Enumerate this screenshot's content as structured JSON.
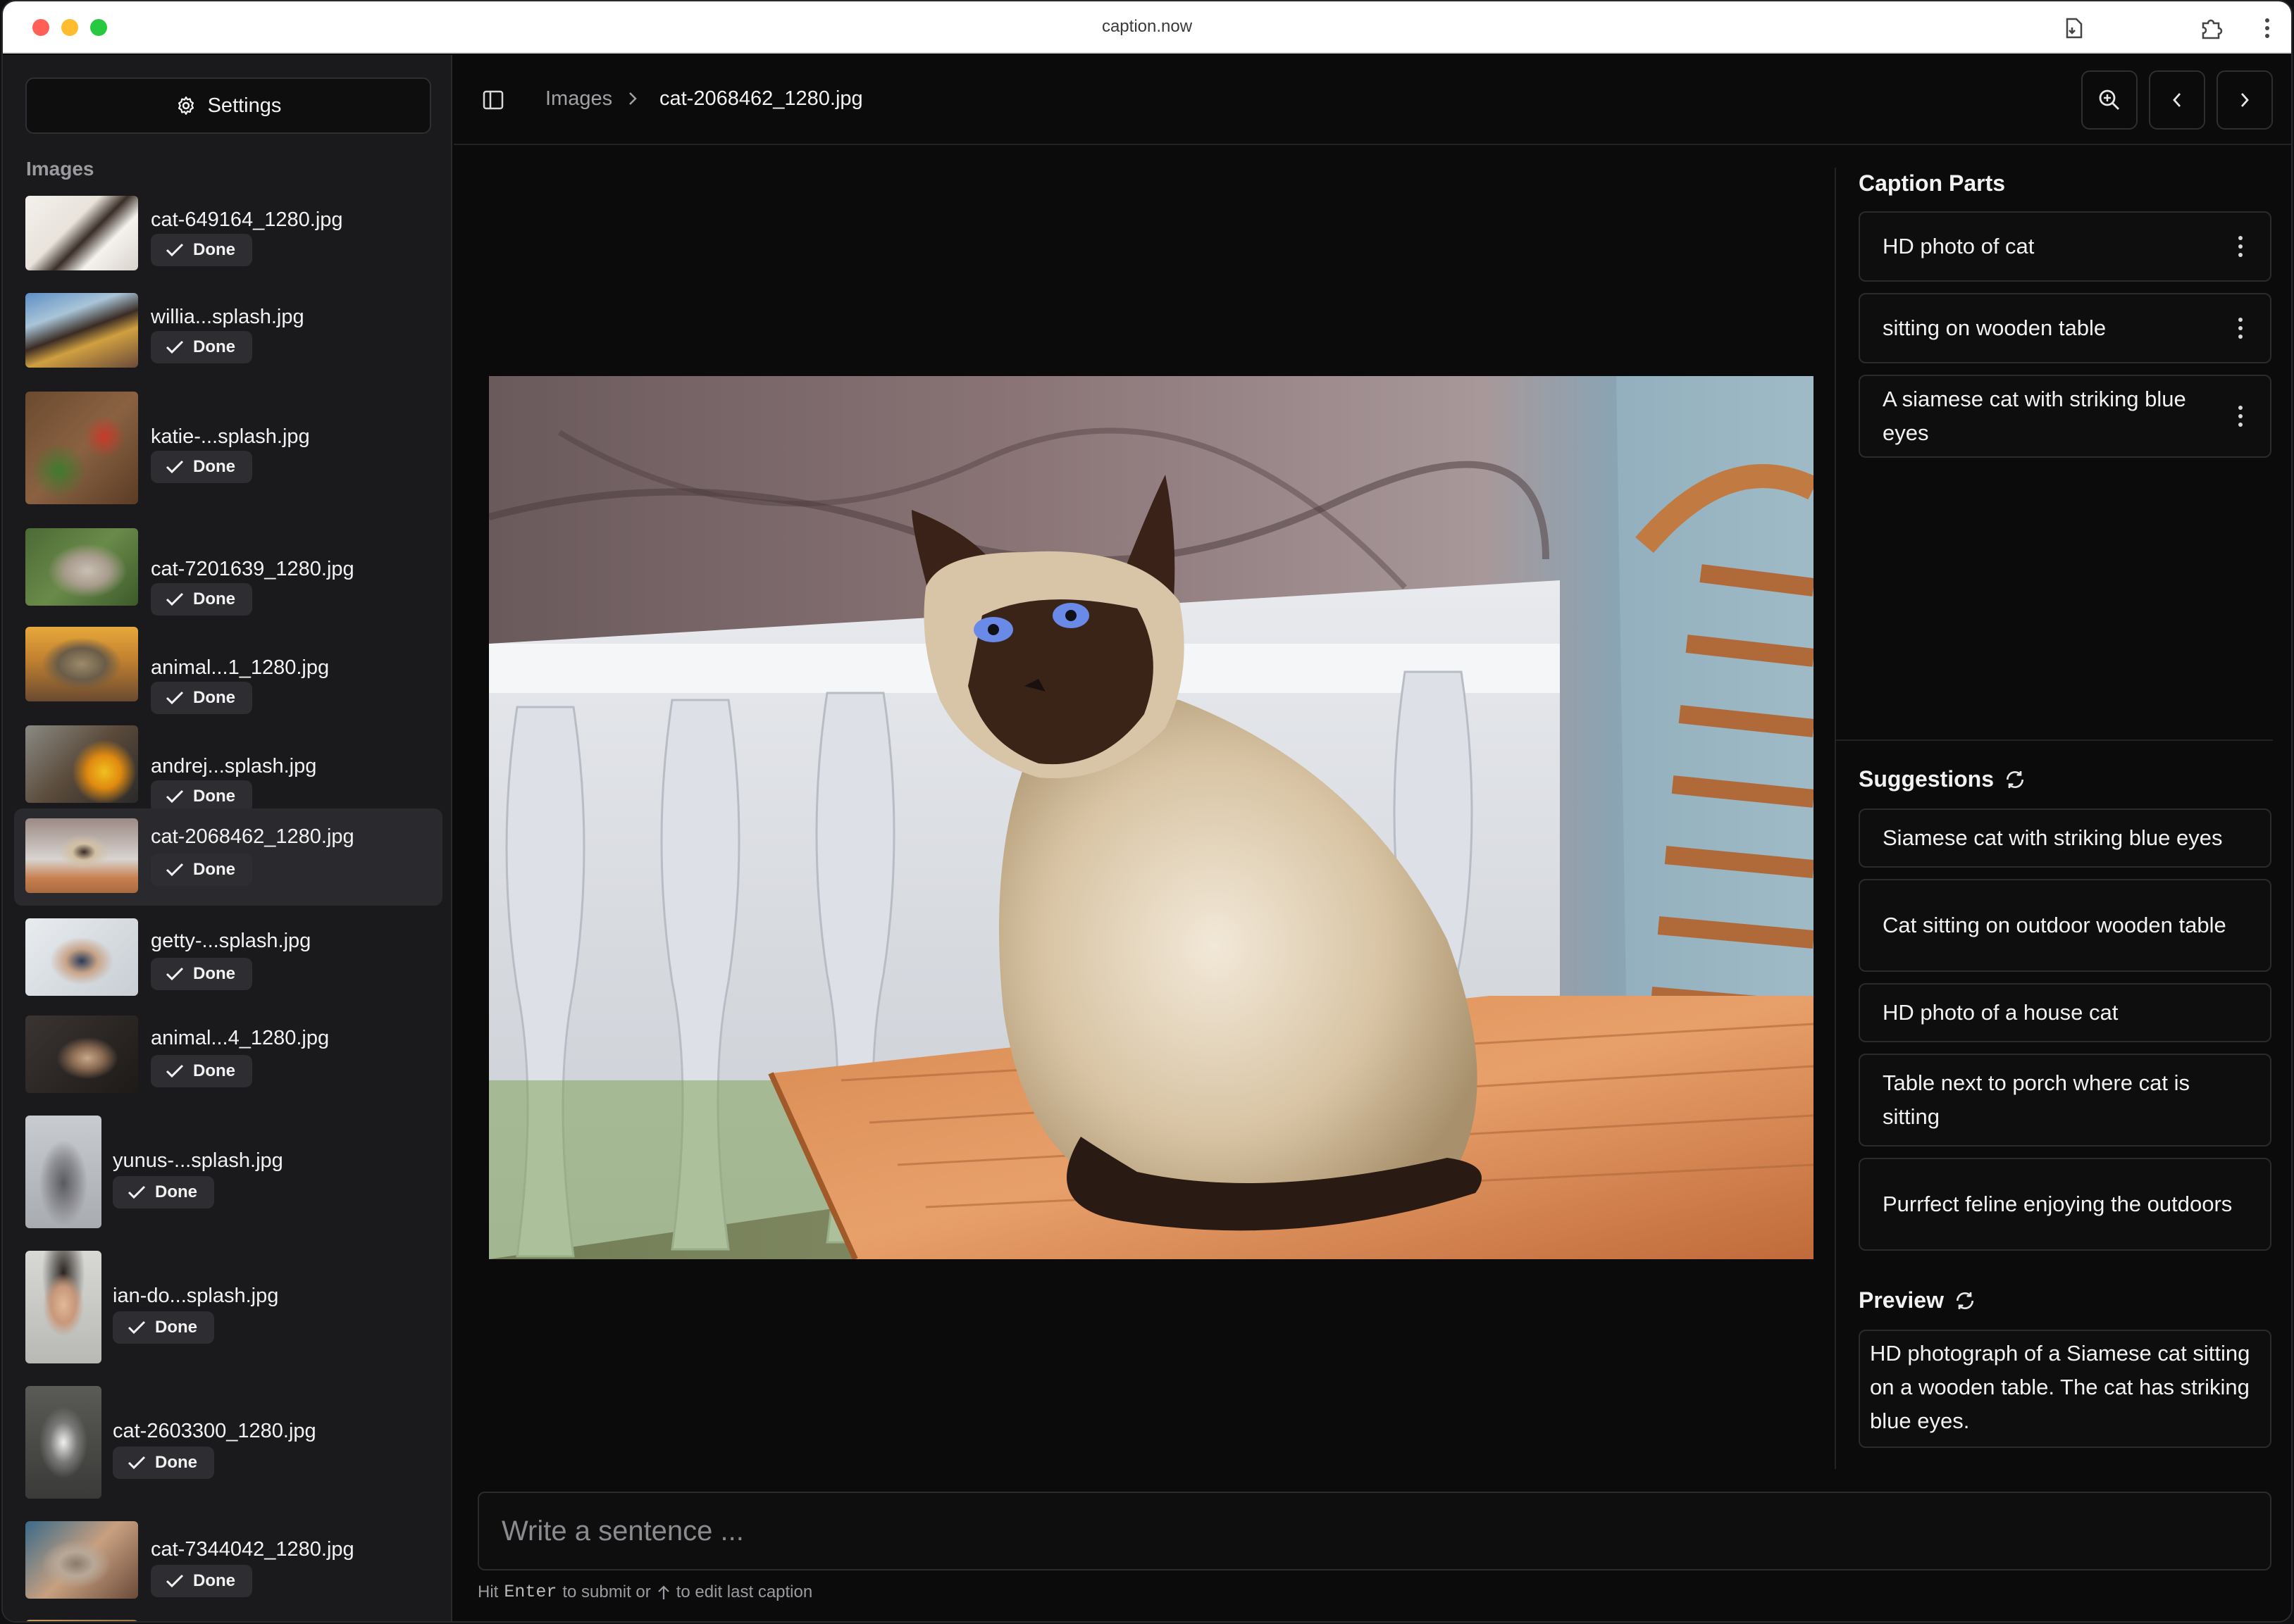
{
  "window": {
    "title": "caption.now"
  },
  "sidebar": {
    "settings_label": "Settings",
    "heading": "Images",
    "items": [
      {
        "name": "cat-649164_1280.jpg",
        "status": "Done"
      },
      {
        "name": "willia...splash.jpg",
        "status": "Done"
      },
      {
        "name": "katie-...splash.jpg",
        "status": "Done"
      },
      {
        "name": "cat-7201639_1280.jpg",
        "status": "Done"
      },
      {
        "name": "animal...1_1280.jpg",
        "status": "Done"
      },
      {
        "name": "andrej...splash.jpg",
        "status": "Done"
      },
      {
        "name": "cat-2068462_1280.jpg",
        "status": "Done",
        "active": true
      },
      {
        "name": "getty-...splash.jpg",
        "status": "Done"
      },
      {
        "name": "animal...4_1280.jpg",
        "status": "Done"
      },
      {
        "name": "yunus-...splash.jpg",
        "status": "Done"
      },
      {
        "name": "ian-do...splash.jpg",
        "status": "Done"
      },
      {
        "name": "cat-2603300_1280.jpg",
        "status": "Done"
      },
      {
        "name": "cat-7344042_1280.jpg",
        "status": "Done"
      }
    ]
  },
  "header": {
    "breadcrumb_root": "Images",
    "breadcrumb_current": "cat-2068462_1280.jpg"
  },
  "caption_parts": {
    "title": "Caption Parts",
    "items": [
      "HD photo of cat",
      "sitting on wooden table",
      "A siamese cat with striking blue eyes"
    ]
  },
  "suggestions": {
    "title": "Suggestions",
    "items": [
      "Siamese cat with striking blue eyes",
      "Cat sitting on outdoor wooden table",
      "HD photo of a house cat",
      "Table next to porch where cat is sitting",
      "Purrfect feline enjoying the outdoors"
    ]
  },
  "preview": {
    "title": "Preview",
    "text": "HD photograph of a Siamese cat sitting on a wooden table. The cat has striking blue eyes."
  },
  "input": {
    "placeholder": "Write a sentence ...",
    "hint_before": "Hit",
    "hint_key": "Enter",
    "hint_middle": "to submit or",
    "hint_after": "to edit last caption"
  },
  "colors": {
    "background": "#0b0b0c",
    "sidebar": "#1a1a1c",
    "active_item": "#2a2a2e",
    "text": "#f2f2f2"
  }
}
